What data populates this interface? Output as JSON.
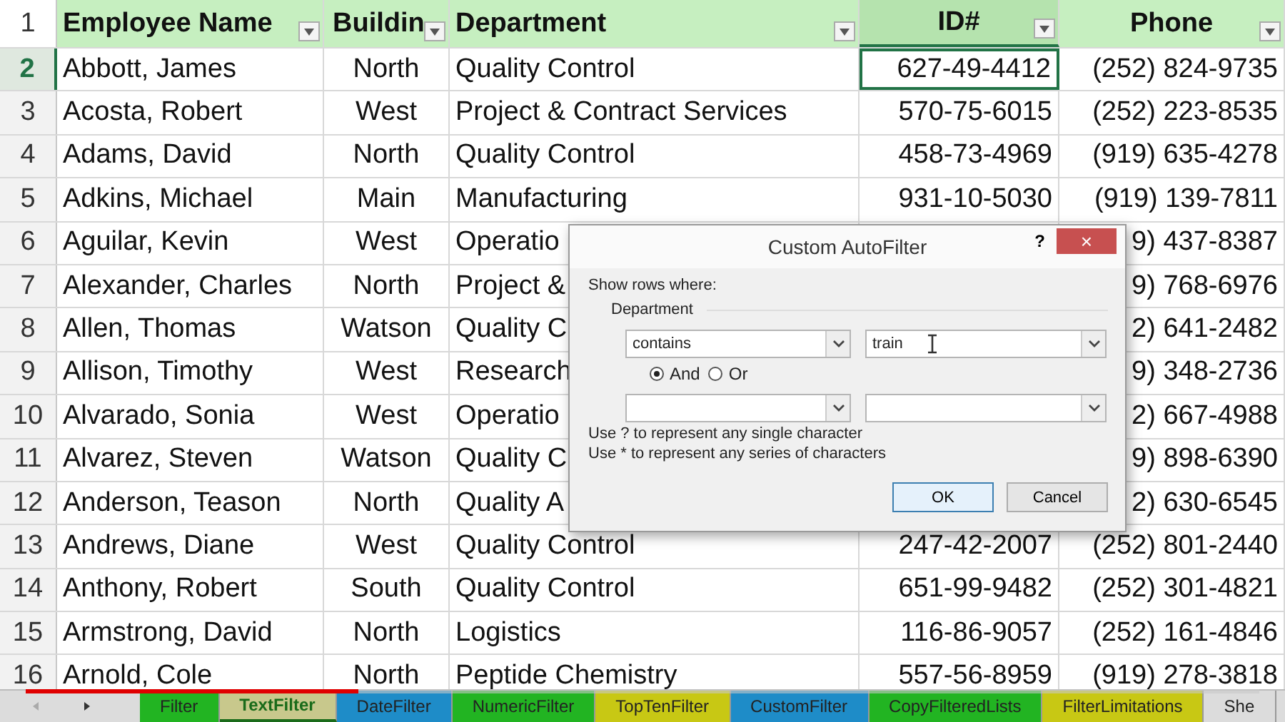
{
  "columns": [
    {
      "label": "Employee Name",
      "selected": false
    },
    {
      "label": "Buildin",
      "selected": false
    },
    {
      "label": "Department",
      "selected": false
    },
    {
      "label": "ID#",
      "selected": true
    },
    {
      "label": "Phone",
      "selected": false
    }
  ],
  "header_row": "1",
  "rows": [
    {
      "number": "2",
      "selected": true,
      "cells": [
        "Abbott, James",
        "North",
        "Quality Control",
        "627-49-4412",
        "(252) 824-9735"
      ]
    },
    {
      "number": "3",
      "selected": false,
      "cells": [
        "Acosta, Robert",
        "West",
        "Project & Contract Services",
        "570-75-6015",
        "(252) 223-8535"
      ]
    },
    {
      "number": "4",
      "selected": false,
      "cells": [
        "Adams, David",
        "North",
        "Quality Control",
        "458-73-4969",
        "(919) 635-4278"
      ]
    },
    {
      "number": "5",
      "selected": false,
      "cells": [
        "Adkins, Michael",
        "Main",
        "Manufacturing",
        "931-10-5030",
        "(919) 139-7811"
      ]
    },
    {
      "number": "6",
      "selected": false,
      "cells": [
        "Aguilar, Kevin",
        "West",
        "Operatio",
        null,
        "9) 437-8387"
      ]
    },
    {
      "number": "7",
      "selected": false,
      "cells": [
        "Alexander, Charles",
        "North",
        "Project &",
        null,
        "9) 768-6976"
      ]
    },
    {
      "number": "8",
      "selected": false,
      "cells": [
        "Allen, Thomas",
        "Watson",
        "Quality C",
        null,
        "2) 641-2482"
      ]
    },
    {
      "number": "9",
      "selected": false,
      "cells": [
        "Allison, Timothy",
        "West",
        "Research",
        null,
        "9) 348-2736"
      ]
    },
    {
      "number": "10",
      "selected": false,
      "cells": [
        "Alvarado, Sonia",
        "West",
        "Operatio",
        null,
        "2) 667-4988"
      ]
    },
    {
      "number": "11",
      "selected": false,
      "cells": [
        "Alvarez, Steven",
        "Watson",
        "Quality C",
        null,
        "9) 898-6390"
      ]
    },
    {
      "number": "12",
      "selected": false,
      "cells": [
        "Anderson, Teason",
        "North",
        "Quality A",
        null,
        "2) 630-6545"
      ]
    },
    {
      "number": "13",
      "selected": false,
      "cells": [
        "Andrews, Diane",
        "West",
        "Quality Control",
        "247-42-2007",
        "(252) 801-2440"
      ]
    },
    {
      "number": "14",
      "selected": false,
      "cells": [
        "Anthony, Robert",
        "South",
        "Quality Control",
        "651-99-9482",
        "(252) 301-4821"
      ]
    },
    {
      "number": "15",
      "selected": false,
      "cells": [
        "Armstrong, David",
        "North",
        "Logistics",
        "116-86-9057",
        "(252) 161-4846"
      ]
    },
    {
      "number": "16",
      "selected": false,
      "cells": [
        "Arnold, Cole",
        "North",
        "Peptide Chemistry",
        "557-56-8959",
        "(919) 278-3818"
      ]
    }
  ],
  "dialog": {
    "title": "Custom AutoFilter",
    "help": "?",
    "close": "×",
    "prompt": "Show rows where:",
    "field": "Department",
    "condition1": {
      "operator": "contains",
      "value": "train"
    },
    "logic": [
      {
        "label": "And",
        "selected": true
      },
      {
        "label": "Or",
        "selected": false
      }
    ],
    "hints": [
      "Use ? to represent any single character",
      "Use * to represent any series of characters"
    ],
    "buttons": [
      {
        "label": "OK",
        "default": true
      },
      {
        "label": "Cancel",
        "default": false
      }
    ]
  },
  "sheet_tabs": [
    {
      "label": "Filter",
      "selected": false,
      "color": "#22b422"
    },
    {
      "label": "TextFilter",
      "selected": true,
      "color": "#c8c88c"
    },
    {
      "label": "DateFilter",
      "selected": false,
      "color": "#1e8cc8"
    },
    {
      "label": "NumericFilter",
      "selected": false,
      "color": "#22b422"
    },
    {
      "label": "TopTenFilter",
      "selected": false,
      "color": "#c8c814"
    },
    {
      "label": "CustomFilter",
      "selected": false,
      "color": "#1e8cc8"
    },
    {
      "label": "CopyFilteredLists",
      "selected": false,
      "color": "#22b422"
    },
    {
      "label": "FilterLimitations",
      "selected": false,
      "color": "#c8c814"
    },
    {
      "label": "She",
      "selected": false,
      "color": "#dcdcdc"
    }
  ],
  "video": {
    "level": 0.27
  }
}
